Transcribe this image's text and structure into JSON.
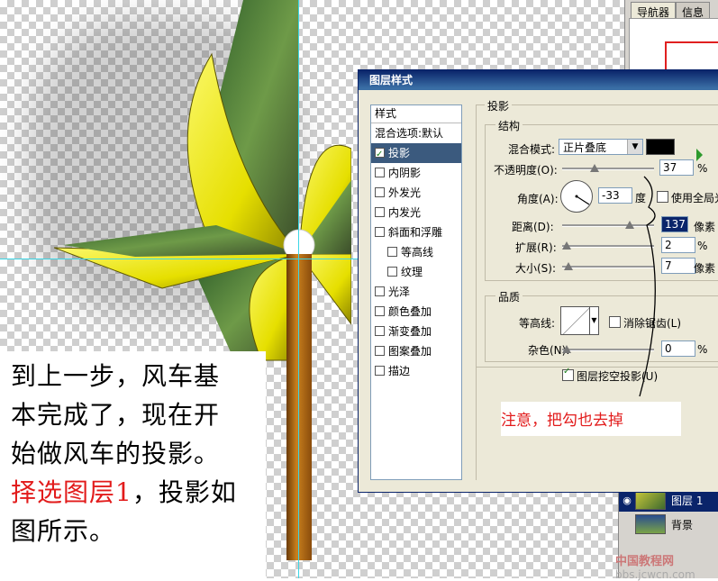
{
  "note": {
    "line1": "到上一步，风车基",
    "line2": "本完成了，现在开",
    "line3": "始做风车的投影。",
    "line4_red": "择选图层1",
    "line4_rest": "，投影如",
    "line5": "图所示。"
  },
  "navigator": {
    "tab1": "导航器",
    "tab2": "信息"
  },
  "dialog": {
    "title": "图层样式",
    "styles_header": "样式",
    "blend_options": "混合选项:默认",
    "items": [
      "投影",
      "内阴影",
      "外发光",
      "内发光",
      "斜面和浮雕",
      "等高线",
      "纹理",
      "光泽",
      "颜色叠加",
      "渐变叠加",
      "图案叠加",
      "描边"
    ],
    "section_title": "投影",
    "structure": {
      "legend": "结构",
      "blend_mode_label": "混合模式:",
      "blend_mode_value": "正片叠底",
      "opacity_label": "不透明度(O):",
      "opacity_value": "37",
      "angle_label": "角度(A):",
      "angle_value": "-33",
      "degree_unit": "度",
      "global_light_label": "使用全局光",
      "distance_label": "距离(D):",
      "distance_value": "137",
      "spread_label": "扩展(R):",
      "spread_value": "2",
      "size_label": "大小(S):",
      "size_value": "7",
      "unit_pct": "%",
      "unit_px": "像素"
    },
    "quality": {
      "legend": "品质",
      "contour_label": "等高线:",
      "antialias_label": "消除锯齿(L)",
      "noise_label": "杂色(N):",
      "noise_value": "0",
      "knockout_label": "图层挖空投影(U)"
    }
  },
  "callout": "注意，把勾也去掉",
  "layers": {
    "layer1": "图层 1",
    "background": "背景"
  },
  "watermark": {
    "site": "中国教程网",
    "url": "bbs.jcwcn.com"
  },
  "colors": {
    "accent": "#0a246a",
    "annotation_red": "#e21b1b",
    "shadow_color": "#000000"
  }
}
